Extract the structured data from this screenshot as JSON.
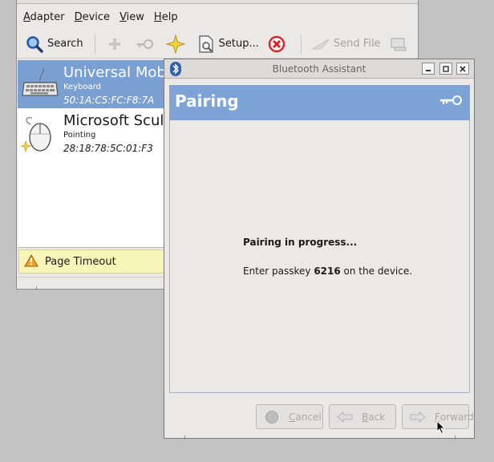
{
  "main_window": {
    "menu": [
      {
        "label": "Adapter",
        "mnemonic": "A",
        "rest": "dapter"
      },
      {
        "label": "Device",
        "mnemonic": "D",
        "rest": "evice"
      },
      {
        "label": "View",
        "mnemonic": "V",
        "rest": "iew"
      },
      {
        "label": "Help",
        "mnemonic": "H",
        "rest": "elp"
      }
    ],
    "toolbar": {
      "search_label": "Search",
      "setup_label": "Setup...",
      "send_file_label": "Send File"
    },
    "devices": [
      {
        "name": "Universal Mobile Keyboard",
        "type": "Keyboard",
        "address": "50:1A:C5:FC:F8:7A",
        "icon": "keyboard-icon",
        "selected": true
      },
      {
        "name": "Microsoft Sculpt Mouse",
        "type": "Pointing",
        "address": "28:18:78:5C:01:F3",
        "icon": "mouse-icon",
        "selected": false
      }
    ],
    "infobar": {
      "message": "Page Timeout",
      "icon": "warning-icon"
    }
  },
  "dialog": {
    "title": "Bluetooth Assistant",
    "header_title": "Pairing",
    "header_icon": "key-icon",
    "heading": "Pairing in progress...",
    "instruction_prefix": "Enter passkey ",
    "passkey": "6216",
    "instruction_suffix": " on the device.",
    "buttons": {
      "cancel_mnemonic": "C",
      "cancel_rest": "ancel",
      "back_mnemonic": "B",
      "back_rest": "ack",
      "forward_mnemonic": "F",
      "forward_rest": "orward"
    }
  },
  "colors": {
    "selection": "#7aa0d2",
    "header": "#7ea3d6",
    "infobar": "#f7f5b8",
    "cancel_red": "#d9262b"
  }
}
